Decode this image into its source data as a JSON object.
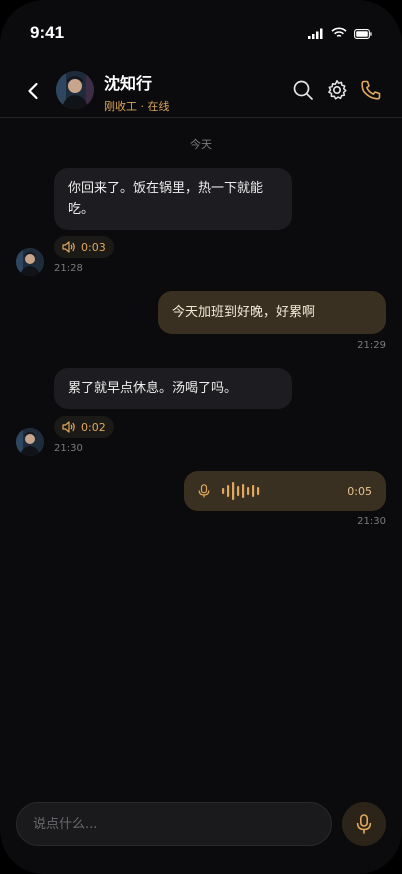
{
  "status_bar": {
    "time": "9:41"
  },
  "header": {
    "contact_name": "沈知行",
    "contact_status": "刚收工 · 在线",
    "icons": [
      "back-chevron-icon",
      "search-icon",
      "gear-icon",
      "phone-icon"
    ]
  },
  "date_separator": "今天",
  "messages": [
    {
      "from": "contact",
      "text": "你回来了。饭在锅里，热一下就能吃。",
      "voice_duration": "0:03",
      "time": "21:28"
    },
    {
      "from": "me",
      "text": "今天加班到好晚，好累啊",
      "time": "21:29"
    },
    {
      "from": "contact",
      "text": "累了就早点休息。汤喝了吗。",
      "voice_duration": "0:02",
      "time": "21:30"
    },
    {
      "from": "me",
      "type": "voice",
      "voice_duration": "0:05",
      "time": "21:30"
    }
  ],
  "composer": {
    "placeholder": "说点什么..."
  },
  "colors": {
    "accent": "#e0a85e",
    "background": "#0b0b0d",
    "bubble_in": "#1d1d21",
    "bubble_out": "#3a3022"
  }
}
